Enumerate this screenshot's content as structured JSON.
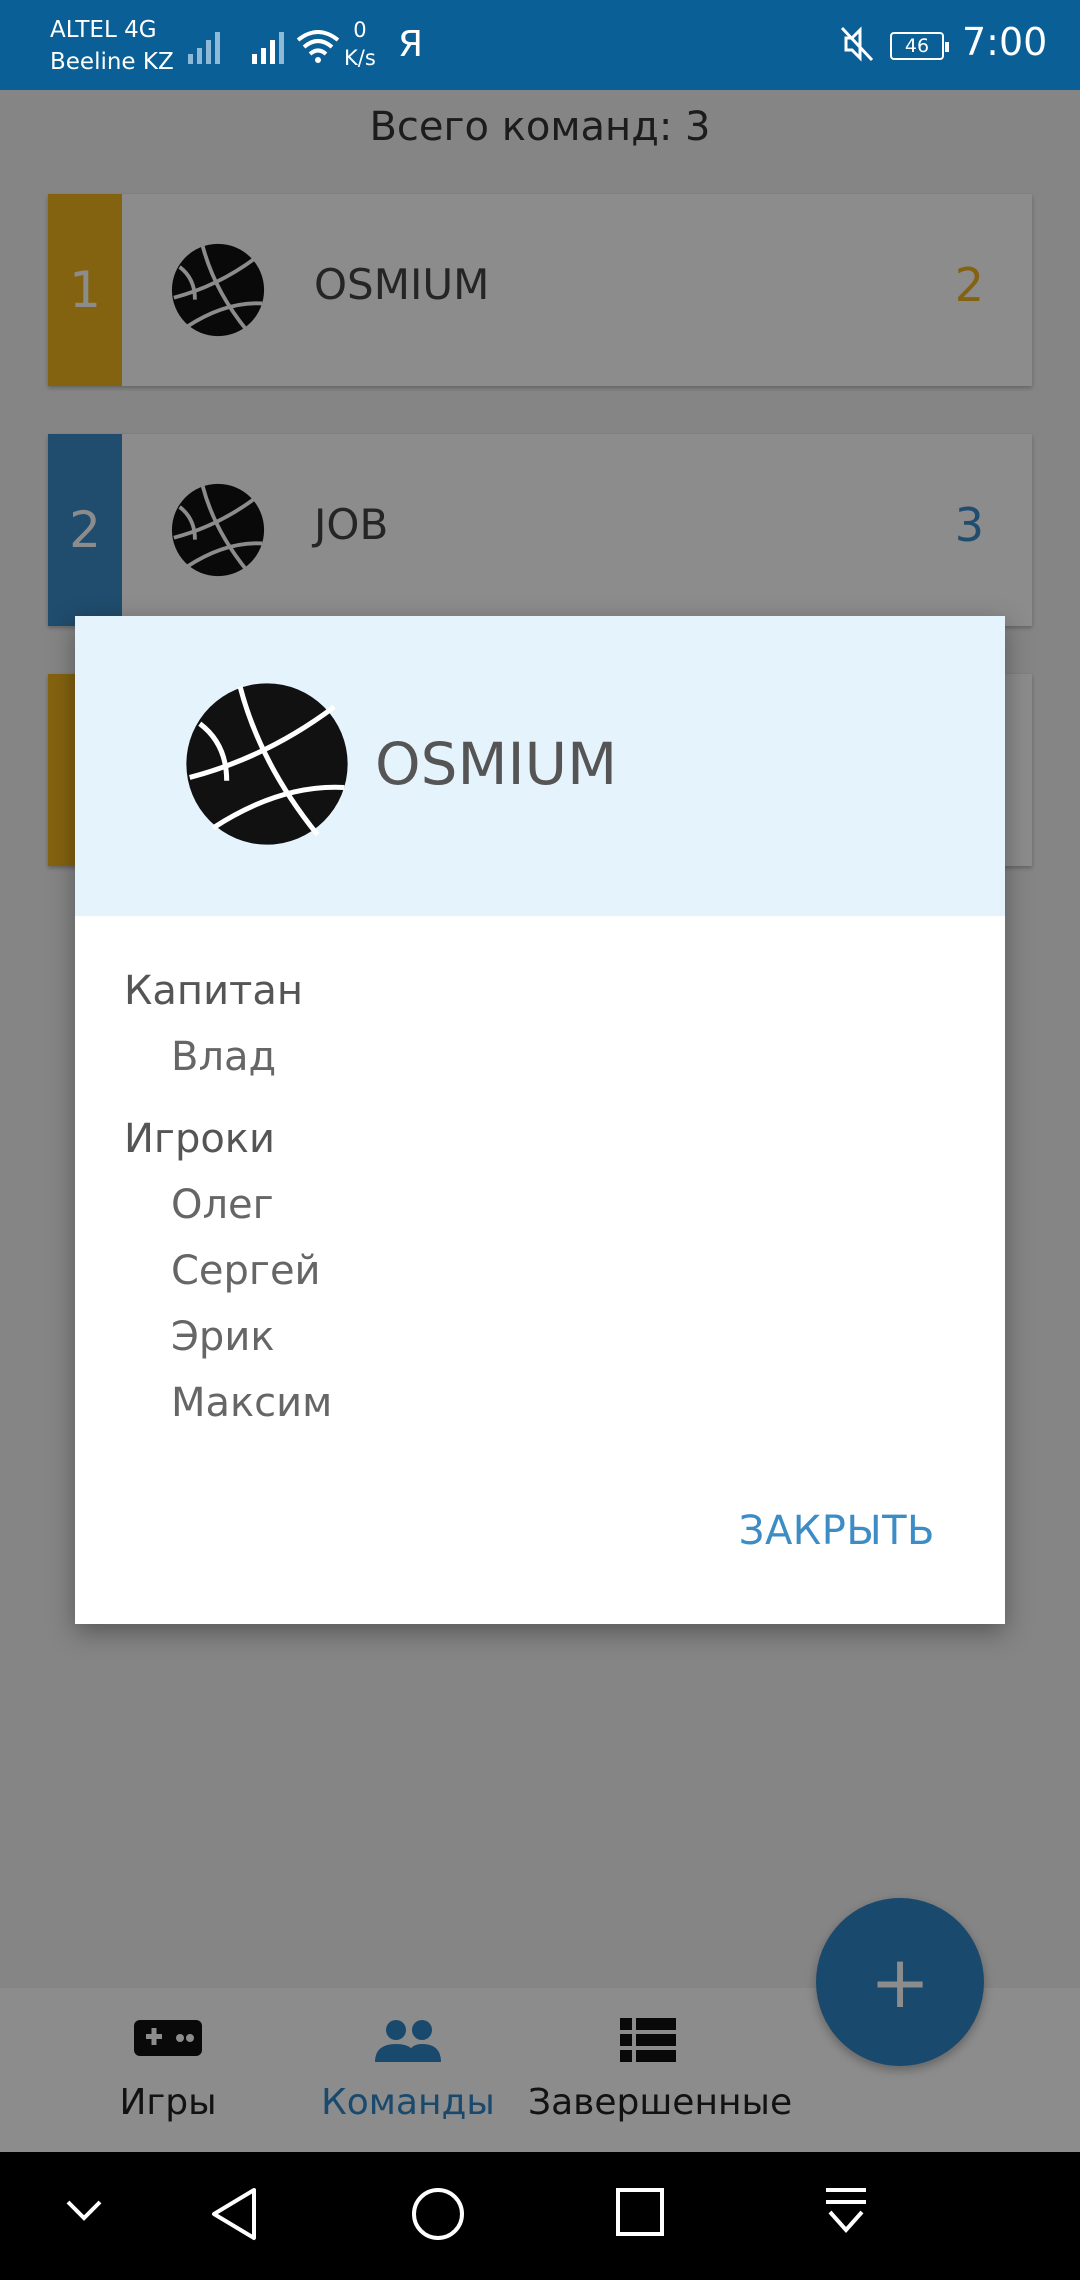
{
  "status_bar": {
    "carrier1": "ALTEL 4G",
    "carrier2": "Beeline KZ",
    "speed_value": "0",
    "speed_unit": "K/s",
    "app_glyph": "Я",
    "battery": "46",
    "time": "7:00",
    "icons": [
      "signal-icon",
      "wifi-icon",
      "mute-icon",
      "battery-icon"
    ]
  },
  "header": {
    "total_label": "Всего команд: 3"
  },
  "teams": [
    {
      "rank": "1",
      "name": "OSMIUM",
      "score": "2",
      "color": "#f0b51e"
    },
    {
      "rank": "2",
      "name": "JOB",
      "score": "3",
      "color": "#3b8bc7"
    },
    {
      "rank": "",
      "name": "",
      "score": "",
      "color": "#f0b51e"
    }
  ],
  "dialog": {
    "team_name": "OSMIUM",
    "captain_heading": "Капитан",
    "captain": "Влад",
    "players_heading": "Игроки",
    "players": [
      "Олег",
      "Сергей",
      "Эрик",
      "Максим"
    ],
    "close_label": "ЗАКРЫТЬ"
  },
  "bottom_nav": {
    "items": [
      {
        "label": "Игры",
        "icon": "gamepad-icon"
      },
      {
        "label": "Команды",
        "icon": "people-icon",
        "active": true
      },
      {
        "label": "Завершенные",
        "icon": "list-icon"
      }
    ],
    "active_color": "#2f86c6"
  },
  "fab": {
    "label": "+"
  },
  "colors": {
    "status_bar": "#0a5f96",
    "accent": "#2f86c6",
    "dialog_header": "#e5f4fc"
  }
}
